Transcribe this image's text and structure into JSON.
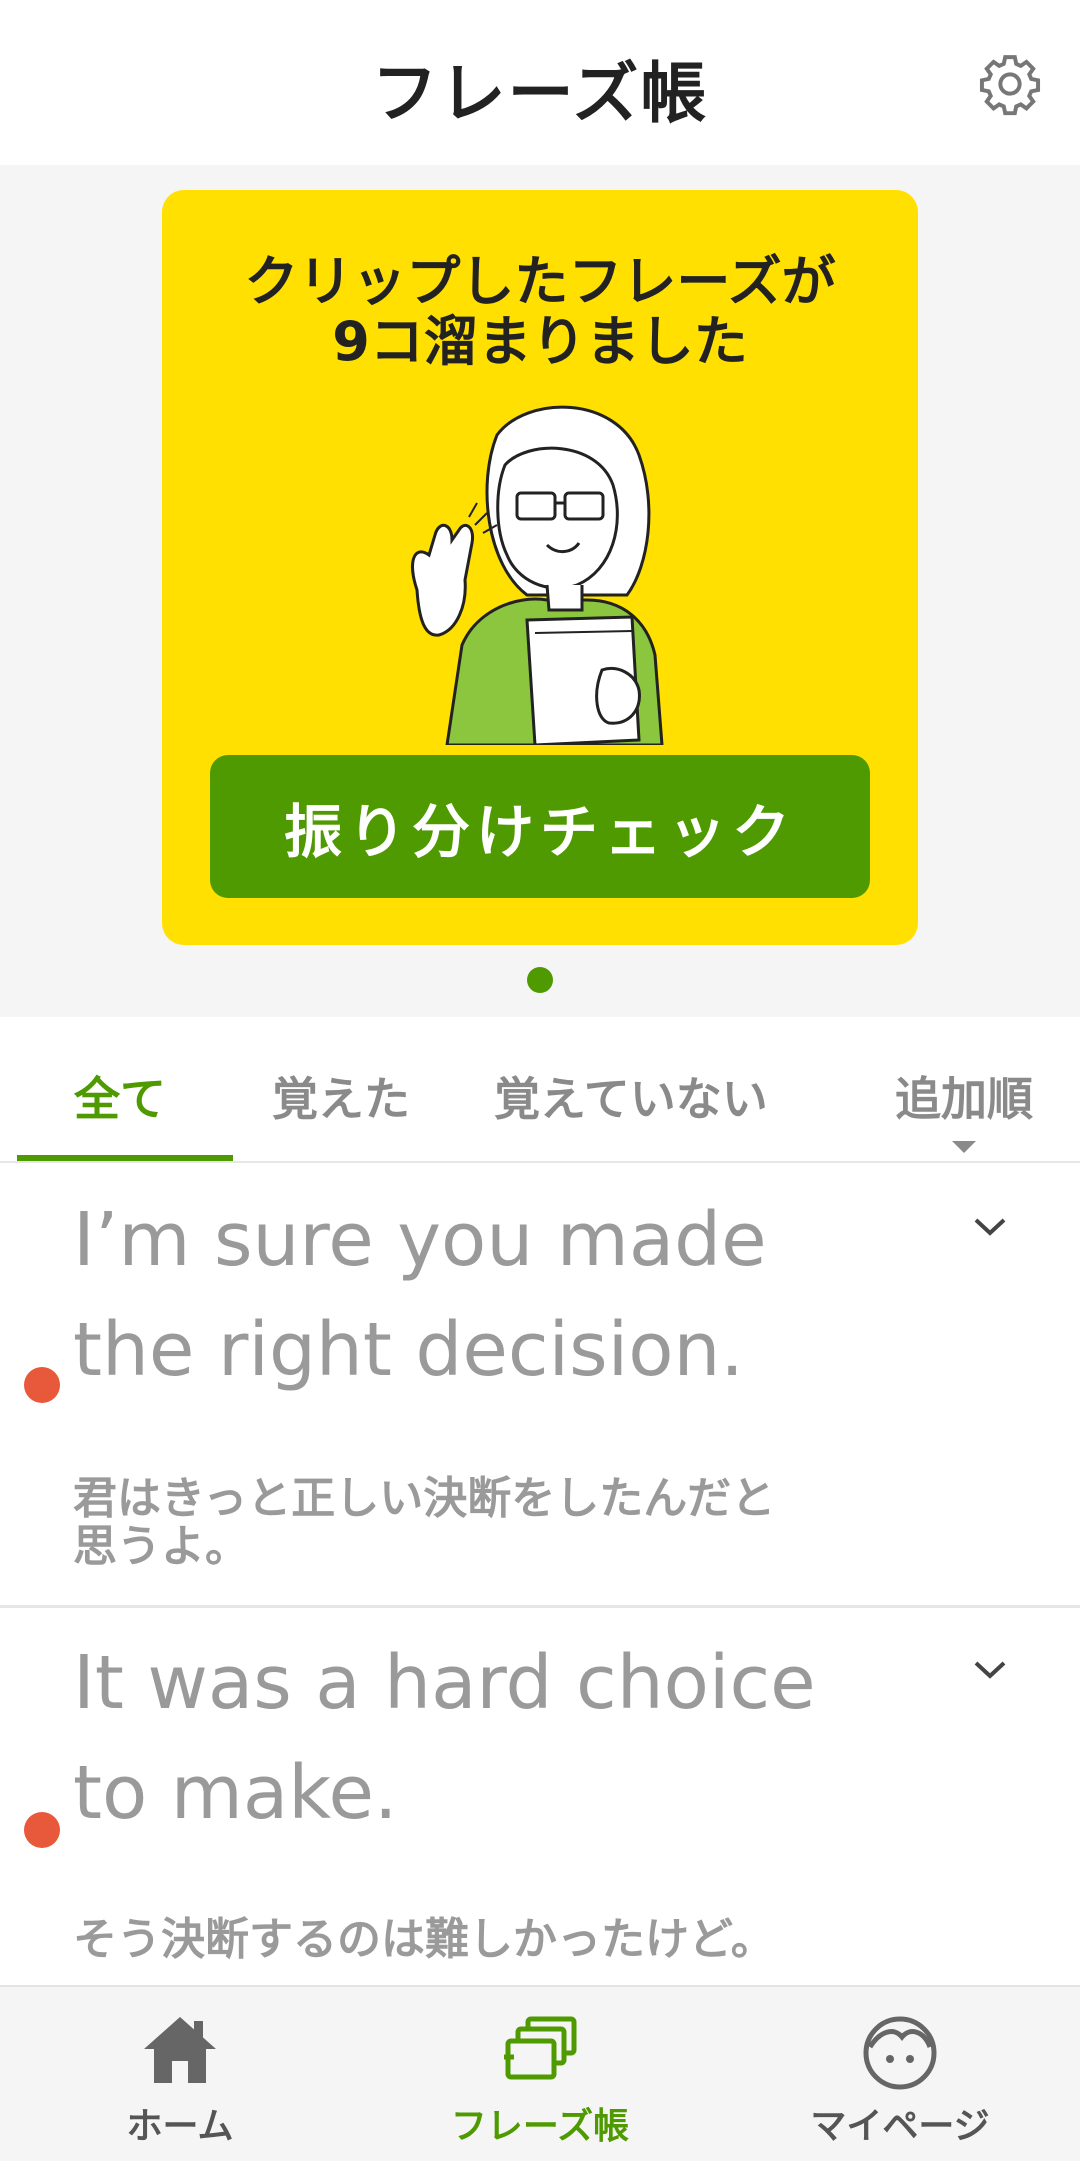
{
  "header": {
    "title": "フレーズ帳"
  },
  "banner": {
    "headline_line1": "クリップしたフレーズが",
    "headline_line2": "9コ溜まりました",
    "cta_label": "振り分けチェック"
  },
  "tabs": [
    {
      "label": "全て",
      "active": true
    },
    {
      "label": "覚えた",
      "active": false
    },
    {
      "label": "覚えていない",
      "active": false
    }
  ],
  "sort": {
    "label": "追加順"
  },
  "phrases": [
    {
      "en_line1": "I’m sure you made",
      "en_line2": "the right decision.",
      "ja_line1": "君はきっと正しい決断をしたんだと",
      "ja_line2": "思うよ。",
      "status_color": "#e8583a"
    },
    {
      "en_line1": "It was a hard choice",
      "en_line2": "to make.",
      "ja_line1": "そう決断するのは難しかったけど。",
      "ja_line2": "",
      "status_color": "#e8583a"
    }
  ],
  "bottom_nav": [
    {
      "label": "ホーム",
      "icon": "home-icon",
      "active": false
    },
    {
      "label": "フレーズ帳",
      "icon": "phrasebook-icon",
      "active": true
    },
    {
      "label": "マイページ",
      "icon": "mypage-icon",
      "active": false
    }
  ],
  "colors": {
    "accent": "#4e9a00",
    "banner_bg": "#ffe000",
    "status_red": "#e8583a"
  }
}
